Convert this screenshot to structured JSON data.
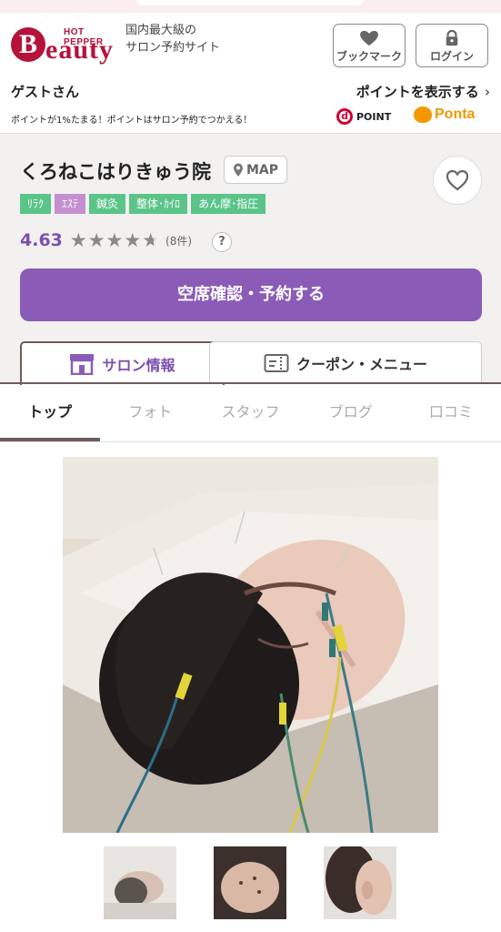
{
  "header": {
    "logo_small": "HOT PEPPER",
    "logo_letter": "B",
    "logo_word": "eauty",
    "tagline_line1": "国内最大級の",
    "tagline_line2": "サロン予約サイト",
    "bookmark_label": "ブックマーク",
    "login_label": "ログイン",
    "guest_label": "ゲストさん",
    "show_points_label": "ポイントを表示する",
    "points_note": "ポイントが1%たまる！ポイントはサロン予約でつかえる！",
    "dpoint_label": "POINT",
    "ponta_label": "Ponta",
    "accent": "#b5133b"
  },
  "salon": {
    "name": "くろねこはりきゅう院",
    "map_label": "MAP",
    "tags": [
      {
        "label": "ﾘﾗｸ",
        "color": "#5bc489"
      },
      {
        "label": "ｴｽﾃ",
        "color": "#c58fd0"
      },
      {
        "label": "鍼灸",
        "color": "#5bc489"
      },
      {
        "label": "整体･ｶｲﾛ",
        "color": "#5bc489"
      },
      {
        "label": "あん摩･指圧",
        "color": "#5bc489"
      }
    ],
    "rating": 4.63,
    "rating_text": "4.63",
    "review_count": "(8件)",
    "help_label": "?",
    "reserve_label": "空席確認・予約する",
    "reserve_color": "#8a5cb8"
  },
  "segments": {
    "salon_info": "サロン情報",
    "coupon_menu": "クーポン・メニュー"
  },
  "tabs": [
    {
      "label": "トップ",
      "active": true
    },
    {
      "label": "フォト",
      "active": false
    },
    {
      "label": "スタッフ",
      "active": false
    },
    {
      "label": "ブログ",
      "active": false
    },
    {
      "label": "口コミ",
      "active": false
    }
  ]
}
